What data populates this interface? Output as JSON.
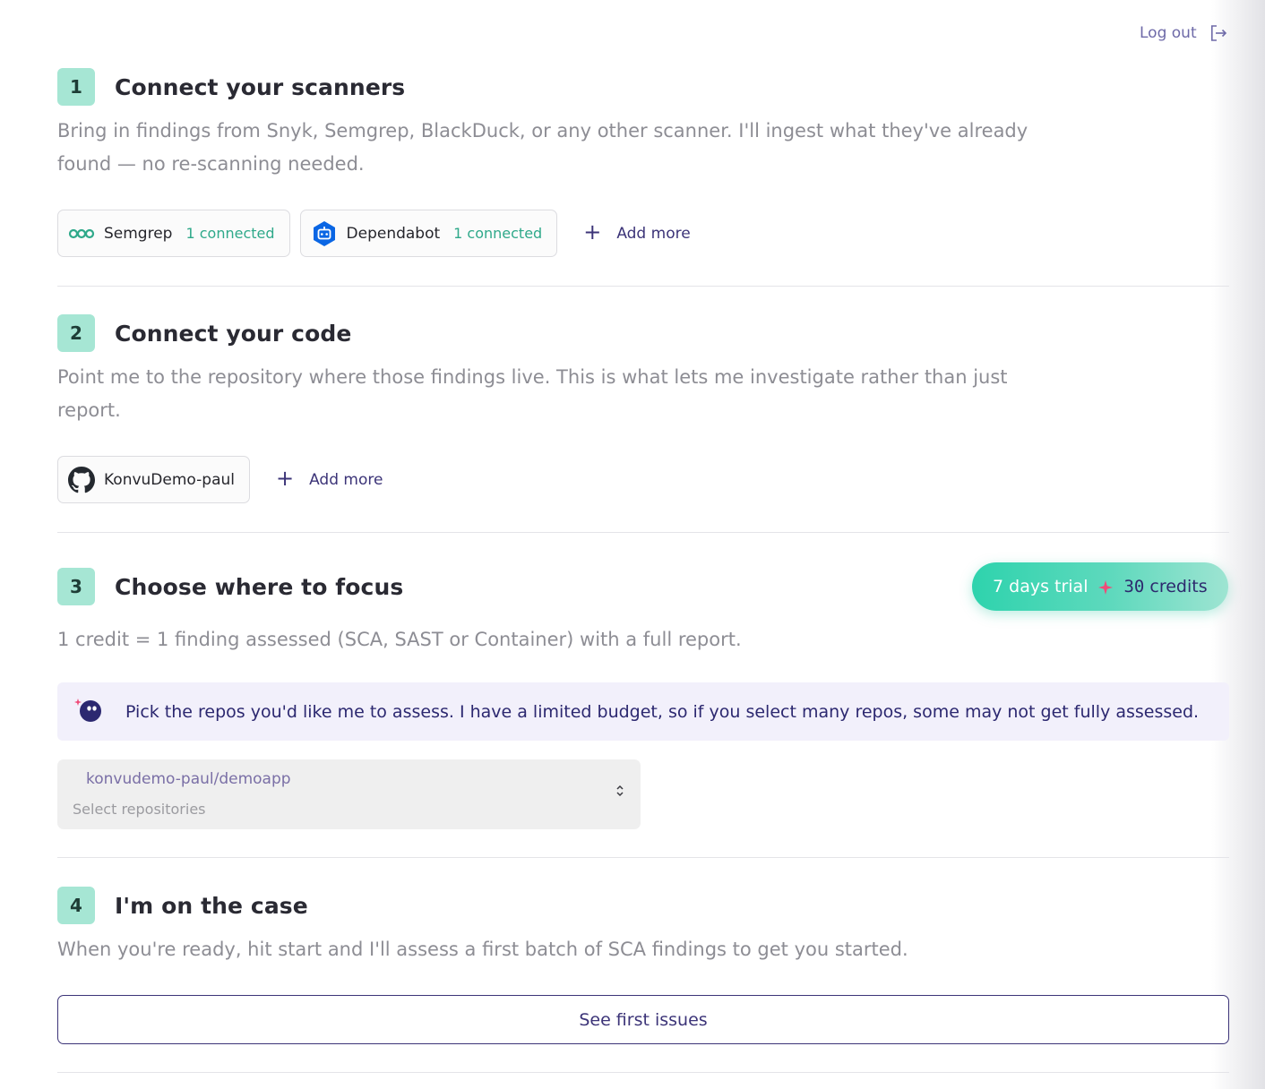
{
  "header": {
    "logout_label": "Log out"
  },
  "steps": [
    {
      "number": "1",
      "title": "Connect your scanners",
      "description": "Bring in findings from Snyk, Semgrep, BlackDuck, or any other scanner. I'll ingest what they've already found — no re-scanning needed.",
      "connections": [
        {
          "name": "Semgrep",
          "count": "1 connected",
          "icon": "semgrep-icon"
        },
        {
          "name": "Dependabot",
          "count": "1 connected",
          "icon": "dependabot-icon"
        }
      ],
      "add_more_label": "Add more"
    },
    {
      "number": "2",
      "title": "Connect your code",
      "description": "Point me to the repository where those findings live. This is what lets me investigate rather than just report.",
      "connections": [
        {
          "name": "KonvuDemo-paul",
          "icon": "github-icon"
        }
      ],
      "add_more_label": "Add more"
    },
    {
      "number": "3",
      "title": "Choose where to focus",
      "description": "1 credit = 1 finding assessed (SCA, SAST or Container) with a full report.",
      "trial": {
        "days_label": "7 days trial",
        "credits_number": "30",
        "credits_word": "credits"
      },
      "notice": "Pick the repos you'd like me to assess. I have a limited budget, so if you select many repos, some may not get fully assessed.",
      "repo_select": {
        "selected": "konvudemo-paul/demoapp",
        "placeholder": "Select repositories"
      }
    },
    {
      "number": "4",
      "title": "I'm on the case",
      "description": "When you're ready, hit start and I'll assess a first batch of SCA findings to get you started.",
      "cta_label": "See first issues"
    }
  ],
  "colors": {
    "accent": "#3c3478",
    "step_badge": "#a6e6d4",
    "connected": "#2fa98a",
    "trial_gradient_start": "#2ed3ad"
  }
}
